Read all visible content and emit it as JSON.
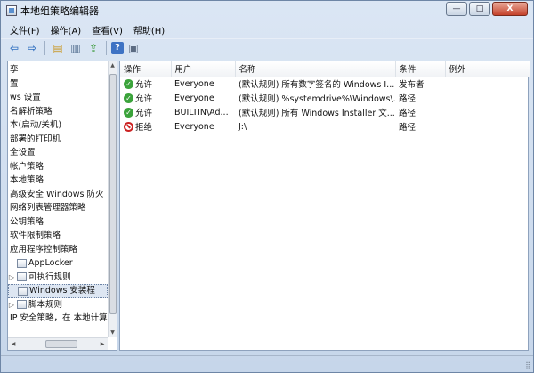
{
  "window": {
    "title": "本地组策略编辑器",
    "min_label": "—",
    "max_label": "□",
    "close_label": "X"
  },
  "menu": [
    "文件(F)",
    "操作(A)",
    "查看(V)",
    "帮助(H)"
  ],
  "toolbar_icons": [
    "back-arrow-icon",
    "forward-arrow-icon",
    "folder-icon",
    "show-hide-tree-icon",
    "export-list-icon",
    "help-icon",
    "properties-icon"
  ],
  "toolbar_glyphs": {
    "back": "⇦",
    "forward": "⇨",
    "folder": "▤",
    "tree": "▥",
    "export": "⇪",
    "help": "?",
    "props": "▣"
  },
  "tree": [
    {
      "label": "孪",
      "expander": "",
      "icon": false
    },
    {
      "label": "置",
      "expander": "",
      "icon": false
    },
    {
      "label": "ws 设置",
      "expander": "",
      "icon": false
    },
    {
      "label": "名解析策略",
      "expander": "",
      "icon": false
    },
    {
      "label": "本(启动/关机)",
      "expander": "",
      "icon": false
    },
    {
      "label": "部署的打印机",
      "expander": "",
      "icon": false
    },
    {
      "label": "全设置",
      "expander": "",
      "icon": false
    },
    {
      "label": "帐户策略",
      "expander": "",
      "icon": false
    },
    {
      "label": "本地策略",
      "expander": "",
      "icon": false
    },
    {
      "label": "高级安全 Windows 防火",
      "expander": "",
      "icon": false
    },
    {
      "label": "网络列表管理器策略",
      "expander": "",
      "icon": false
    },
    {
      "label": "公钥策略",
      "expander": "",
      "icon": false
    },
    {
      "label": "软件限制策略",
      "expander": "",
      "icon": false
    },
    {
      "label": "应用程序控制策略",
      "expander": "",
      "icon": false
    },
    {
      "label": "AppLocker",
      "expander": "",
      "icon": true
    },
    {
      "label": "可执行规则",
      "expander": "▷",
      "icon": true
    },
    {
      "label": "Windows 安装程",
      "expander": "",
      "icon": true,
      "selected": true
    },
    {
      "label": "脚本规则",
      "expander": "▷",
      "icon": true
    },
    {
      "label": "IP 安全策略，在 本地计算",
      "expander": "",
      "icon": false
    }
  ],
  "columns": [
    "操作",
    "用户",
    "名称",
    "条件",
    "例外"
  ],
  "rows": [
    {
      "action": "允许",
      "status": "allow",
      "user": "Everyone",
      "name": "(默认规则) 所有数字签名的 Windows I...",
      "condition": "发布者",
      "exception": ""
    },
    {
      "action": "允许",
      "status": "allow",
      "user": "Everyone",
      "name": "(默认规则) %systemdrive%\\Windows\\...",
      "condition": "路径",
      "exception": ""
    },
    {
      "action": "允许",
      "status": "allow",
      "user": "BUILTIN\\Ad...",
      "name": "(默认规则) 所有 Windows Installer 文...",
      "condition": "路径",
      "exception": ""
    },
    {
      "action": "拒绝",
      "status": "deny",
      "user": "Everyone",
      "name": "J:\\",
      "condition": "路径",
      "exception": ""
    }
  ],
  "scroll": {
    "up": "▲",
    "down": "▼",
    "left": "◀",
    "right": "▶",
    "grip": "⣿"
  }
}
